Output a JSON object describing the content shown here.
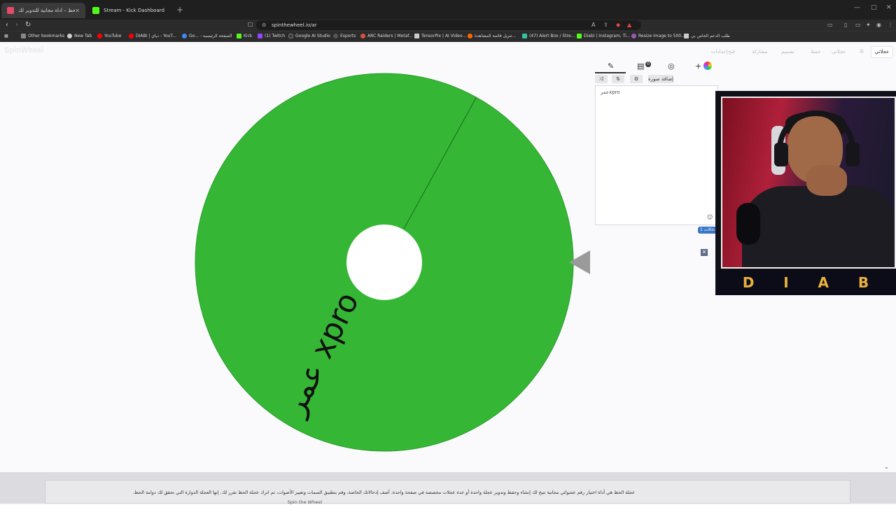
{
  "browser": {
    "tabs": [
      {
        "title": "عجلة الحظ – أداة مجانية للتدوير لك",
        "favicon_color": "#e24b6a",
        "active": true
      },
      {
        "title": "Stream - Kick Dashboard",
        "favicon_color": "#53fc18",
        "active": false
      }
    ],
    "new_tab": "+",
    "url": "spinthewheel.io/ar",
    "window_controls": [
      "—",
      "▢",
      "✕"
    ],
    "bookmarks": [
      {
        "label": "Other bookmarks",
        "color": "#888"
      },
      {
        "label": "New Tab",
        "color": "#ccc"
      },
      {
        "label": "YouTube",
        "color": "#ff0000"
      },
      {
        "label": "DIABI | دياي - YouT...",
        "color": "#ff0000"
      },
      {
        "label": "Go... - الصفحة الرئيسية",
        "color": "#4285f4"
      },
      {
        "label": "Kick",
        "color": "#53fc18"
      },
      {
        "label": "(1) Twitch",
        "color": "#9146ff"
      },
      {
        "label": "Google AI Studio",
        "color": "#333"
      },
      {
        "label": "Esports",
        "color": "#555"
      },
      {
        "label": "ARC Raiders | Metaf...",
        "color": "#d4553a"
      },
      {
        "label": "TensorPix | AI Video...",
        "color": "#ccc"
      },
      {
        "label": "تنزيل قائمة المشاهدة...",
        "color": "#f06"
      },
      {
        "label": "(47) Alert Box / Stre...",
        "color": "#31c3a2"
      },
      {
        "label": "Diabi | Instagram, Ti...",
        "color": "#53fc18"
      },
      {
        "label": "Resize image to 500...",
        "color": "#9b59b6"
      },
      {
        "label": "طلب الدعم الخاص بي",
        "color": "#ccc"
      }
    ]
  },
  "site": {
    "logo": "SpinWheel",
    "nav": [
      "عجلاتي",
      "حفظ",
      "فتح",
      "مشاركة",
      "تصميم",
      "إعدادات"
    ],
    "top_button": "عجلاتي"
  },
  "wheel": {
    "segments": [
      "عمر xpro"
    ],
    "color": "#35b735",
    "pointer_color": "#9a9a9a"
  },
  "editor": {
    "tabs": [
      "edit-icon",
      "list-icon",
      "hide-icon",
      "add-color-icon"
    ],
    "list_badge": "0",
    "actions": [
      "shuffle-icon",
      "sort-icon",
      "settings-icon",
      "إضافة صورة"
    ],
    "entries_text": "عمرxpro",
    "count_label": "إدخالات 1"
  },
  "overlay": {
    "letters": [
      "D",
      "I",
      "A",
      "B"
    ]
  },
  "footer": {
    "text": "عجلة الحظ هي أداة اختيار رقم عشوائي مجانية تتيح لك إنشاء وحفظ وتدوير عجلة واحدة أو عدة عجلات مخصصة في صفحة واحدة. أضف إدخالاتك الخاصة، وقم بتطبيق السمات وتغيير الأصوات، ثم اترك عجلة الحظ تقرر لك. إنها العجلة الدوارة التي تحقق لك دوامة الحظ.",
    "text2": "Spin the Wheel"
  }
}
